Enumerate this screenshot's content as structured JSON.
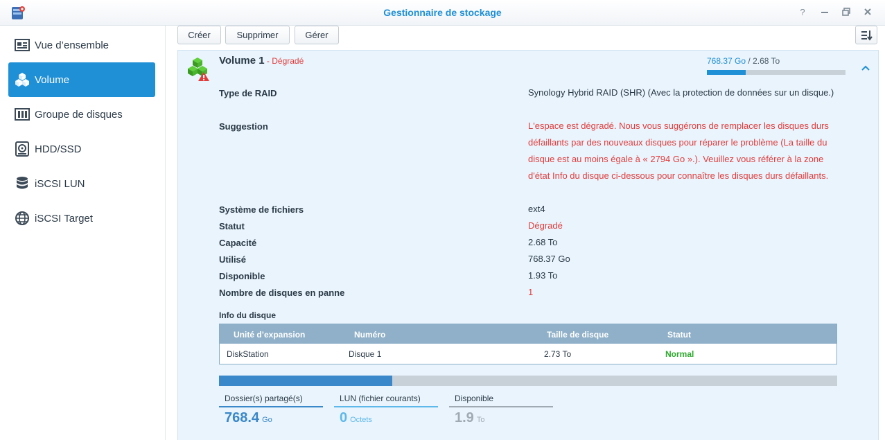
{
  "window": {
    "title": "Gestionnaire de stockage",
    "controls": [
      "help-icon",
      "minimize-icon",
      "restore-icon",
      "close-icon"
    ]
  },
  "sidebar": {
    "items": [
      {
        "label": "Vue d’ensemble",
        "icon": "overview-icon",
        "active": false
      },
      {
        "label": "Volume",
        "icon": "volume-cubes-icon",
        "active": true
      },
      {
        "label": "Groupe de disques",
        "icon": "disk-group-icon",
        "active": false
      },
      {
        "label": "HDD/SSD",
        "icon": "hdd-icon",
        "active": false
      },
      {
        "label": "iSCSI LUN",
        "icon": "database-icon",
        "active": false
      },
      {
        "label": "iSCSI Target",
        "icon": "globe-icon",
        "active": false
      }
    ]
  },
  "toolbar": {
    "create_label": "Créer",
    "delete_label": "Supprimer",
    "manage_label": "Gérer"
  },
  "volume": {
    "name": "Volume 1",
    "separator": " - ",
    "status": "Dégradé",
    "used": "768.37 Go",
    "usage_sep": " / ",
    "total": "2.68 To",
    "usage_fraction": 0.28,
    "properties": [
      {
        "label": "Type de RAID",
        "value": "Synology Hybrid RAID (SHR) (Avec la protection de données sur un disque.)",
        "red": false
      },
      {
        "label": "Suggestion",
        "value": "L'espace est dégradé. Nous vous suggérons de remplacer les disques durs défaillants par des nouveaux disques pour réparer le problème (La taille du disque est au moins égale à « 2794 Go ».). Veuillez vous référer à la zone d'état Info du disque ci-dessous pour connaître les disques durs défaillants.",
        "red": true
      },
      {
        "label": "Système de fichiers",
        "value": "ext4",
        "red": false
      },
      {
        "label": "Statut",
        "value": "Dégradé",
        "red": true
      },
      {
        "label": "Capacité",
        "value": "2.68 To",
        "red": false
      },
      {
        "label": "Utilisé",
        "value": "768.37 Go",
        "red": false
      },
      {
        "label": "Disponible",
        "value": "1.93 To",
        "red": false
      },
      {
        "label": "Nombre de disques en panne",
        "value": "1",
        "red": true
      }
    ]
  },
  "disk_info": {
    "title": "Info du disque",
    "columns": [
      "Unité d’expansion",
      "Numéro",
      "Taille de disque",
      "Statut"
    ],
    "rows": [
      [
        "DiskStation",
        "Disque 1",
        "2.73 To",
        "Normal"
      ]
    ]
  },
  "allocation": {
    "used_fraction": 0.28,
    "stats": [
      {
        "label": "Dossier(s) partagé(s)",
        "value": "768.4",
        "unit": "Go",
        "color": "#3a87c9"
      },
      {
        "label": "LUN (fichier courants)",
        "value": "0",
        "unit": "Octets",
        "color": "#5fb8ea"
      },
      {
        "label": "Disponible",
        "value": "1.9",
        "unit": "To",
        "color": "#a0aab3"
      }
    ]
  },
  "colors": {
    "accent": "#1f8fd6",
    "danger": "#e03c3c",
    "success": "#2ea82e",
    "panel_bg": "#e9f4fc"
  }
}
